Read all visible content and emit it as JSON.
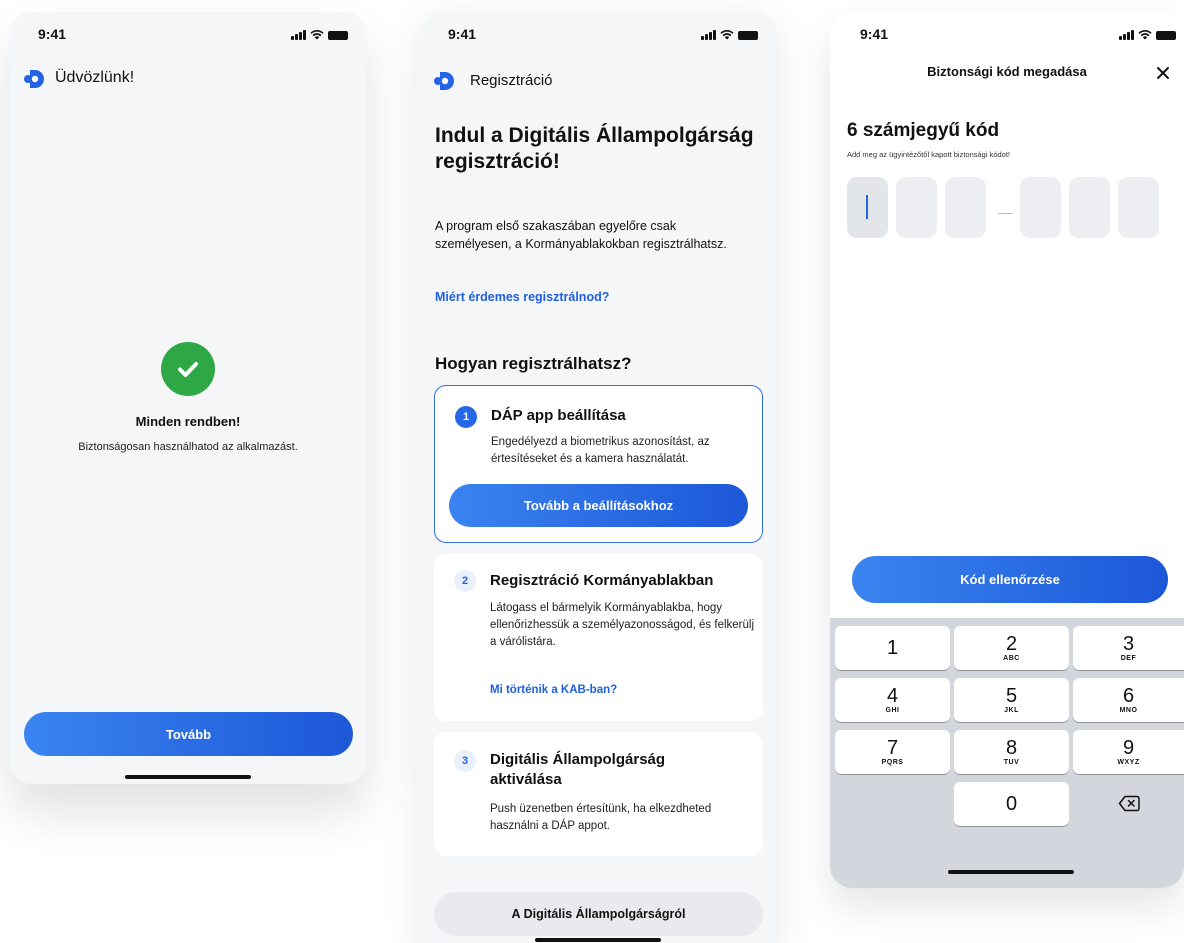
{
  "status": {
    "time": "9:41"
  },
  "welcome": {
    "nav_title": "Üdvözlünk!",
    "success_title": "Minden rendben!",
    "success_subtitle": "Biztonságosan használhatod az alkalmazást.",
    "continue_button": "Tovább",
    "colors": {
      "accent": "#2563e5",
      "success": "#2ea845"
    }
  },
  "registration": {
    "nav_title": "Regisztráció",
    "headline": "Indul a Digitális Állampolgárság regisztráció!",
    "intro": "A program első szakaszában egyelőre csak személyesen, a Kormányablakokban regisztrálhatsz.",
    "why_link": "Miért érdemes regisztrálnod?",
    "how_heading": "Hogyan regisztrálhatsz?",
    "steps": [
      {
        "number": "1",
        "title": "DÁP app beállítása",
        "text": "Engedélyezd a biometrikus azonosítást, az értesítéseket és a kamera használatát.",
        "button": "Tovább a beállításokhoz"
      },
      {
        "number": "2",
        "title": "Regisztráció Kormányablakban",
        "text": "Látogass el bármelyik Kormányablakba, hogy ellenőrizhessük a személyazonosságod, és felkerülj a várólistára.",
        "link": "Mi történik a KAB-ban?"
      },
      {
        "number": "3",
        "title": "Digitális Állampolgárság aktiválása",
        "text": "Push üzenetben értesítünk, ha elkezdheted használni a DÁP appot."
      }
    ],
    "about_button": "A Digitális Állampolgárságról"
  },
  "code_entry": {
    "nav_title": "Biztonsági kód megadása",
    "heading": "6 számjegyű kód",
    "subtitle": "Add meg az ügyintézőtől kapott biztonsági kódot!",
    "verify_button": "Kód ellenőrzése",
    "keys": [
      {
        "num": "1",
        "letters": ""
      },
      {
        "num": "2",
        "letters": "ABC"
      },
      {
        "num": "3",
        "letters": "DEF"
      },
      {
        "num": "4",
        "letters": "GHI"
      },
      {
        "num": "5",
        "letters": "JKL"
      },
      {
        "num": "6",
        "letters": "MNO"
      },
      {
        "num": "7",
        "letters": "PQRS"
      },
      {
        "num": "8",
        "letters": "TUV"
      },
      {
        "num": "9",
        "letters": "WXYZ"
      },
      {
        "num": "0",
        "letters": ""
      }
    ]
  }
}
